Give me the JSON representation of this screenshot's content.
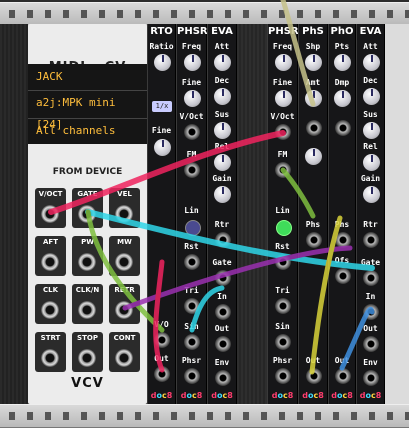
{
  "midi_module": {
    "title": "MIDI ▸ CV",
    "driver": "JACK",
    "device": "a2j:MPK mini [24]",
    "channel": "All channels",
    "section": "FROM DEVICE",
    "logo": "VCV",
    "outputs": [
      "V/OCT",
      "GATE",
      "VEL",
      "AFT",
      "PW",
      "MW",
      "CLK",
      "CLK/N",
      "RETR",
      "STRT",
      "STOP",
      "CONT"
    ]
  },
  "rto_module": {
    "title": "RTO",
    "labels": [
      "Ratio",
      "Fine",
      "V/O",
      "Out"
    ],
    "button": "1/x"
  },
  "phsr1_module": {
    "title": "PHSR",
    "labels": [
      "Freq",
      "Fine",
      "V/Oct",
      "FM",
      "Lin",
      "Rst",
      "Tri",
      "Sin",
      "Phsr"
    ]
  },
  "eva1_module": {
    "title": "EVA",
    "labels": [
      "Att",
      "Dec",
      "Sus",
      "Rel",
      "Gain",
      "Rtr",
      "Gate",
      "In",
      "Out",
      "Env"
    ]
  },
  "phsr2_module": {
    "title": "PHSR",
    "labels": [
      "Freq",
      "Fine",
      "V/Oct",
      "FM",
      "Lin",
      "Rst",
      "Tri",
      "Sin",
      "Phsr"
    ]
  },
  "phs_module": {
    "title": "PhS",
    "labels": [
      "Shp",
      "Amt",
      "Phs",
      "Out"
    ]
  },
  "pho_module": {
    "title": "PhO",
    "labels": [
      "Pts",
      "Dmp",
      "Phs",
      "Ofs",
      "Out"
    ]
  },
  "eva2_module": {
    "title": "EVA",
    "labels": [
      "Att",
      "Dec",
      "Sus",
      "Rel",
      "Gain",
      "Rtr",
      "Gate",
      "In",
      "Out",
      "Env"
    ]
  },
  "brand_logo": "doc8",
  "colors": {
    "cable_pink": "#f0245f",
    "cable_cyan": "#2fd6e8",
    "cable_green": "#7fbf3f",
    "cable_blue": "#3f8fdf",
    "cable_yellow": "#d8d23a",
    "cable_purple": "#9a30b0",
    "screen_text": "#ffbe3c",
    "panel_dark": "#161618"
  }
}
